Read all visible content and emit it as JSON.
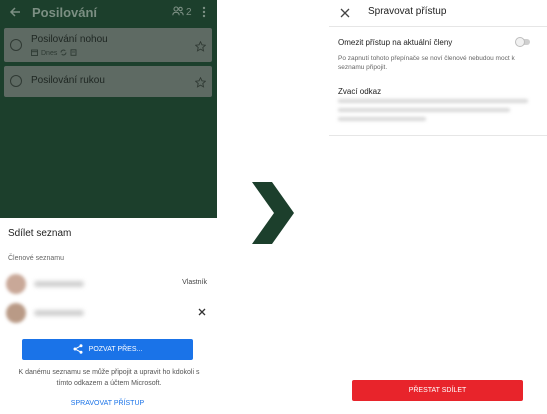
{
  "left": {
    "list": {
      "title": "Posilování",
      "member_count": "2",
      "icons": {
        "back": "back-arrow-icon",
        "members": "people-icon",
        "more": "more-vert-icon"
      },
      "tasks": [
        {
          "name": "Posilování nohou",
          "due": "Dnes",
          "icons": [
            "calendar-icon",
            "repeat-icon",
            "note-icon"
          ],
          "star": "star-outline-icon"
        },
        {
          "name": "Posilování rukou",
          "star": "star-outline-icon"
        }
      ]
    },
    "share_sheet": {
      "title": "Sdílet seznam",
      "members_label": "Členové seznamu",
      "members": [
        {
          "role": "Vlastník"
        },
        {
          "action_icon": "close-icon"
        }
      ],
      "invite_button": "POZVAT PŘES...",
      "invite_icon": "share-icon",
      "info": "K danému seznamu se může připojit a upravit ho kdokoli s tímto odkazem a účtem Microsoft.",
      "manage_link": "SPRAVOVAT PŘÍSTUP"
    }
  },
  "arrow_icon": "chevron-right-icon",
  "right": {
    "title": "Spravovat přístup",
    "close_icon": "close-icon",
    "limit_access_label": "Omezit přístup na aktuální členy",
    "limit_access_on": false,
    "limit_access_desc": "Po zapnutí tohoto přepínače se noví členové nebudou moct k seznamu připojit.",
    "invite_link_label": "Zvací odkaz",
    "stop_sharing_button": "PŘESTAT SDÍLET"
  },
  "colors": {
    "list_background": "#1c3f2c",
    "primary_button": "#1a73e8",
    "danger_button": "#e8242b",
    "arrow": "#1c3f2c"
  }
}
